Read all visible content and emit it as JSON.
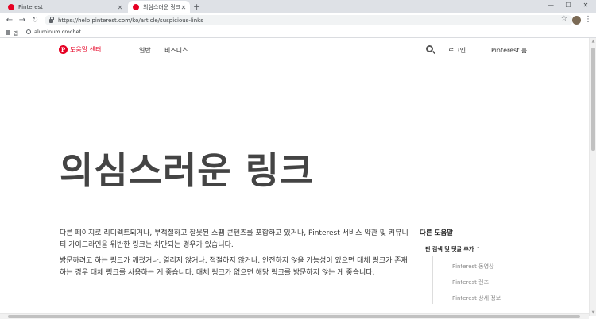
{
  "browser": {
    "tabs": [
      {
        "title": "Pinterest",
        "active": false
      },
      {
        "title": "의심스러운 링크 | Pinterest help",
        "active": true
      }
    ],
    "new_tab": "+",
    "url": "https://help.pinterest.com/ko/article/suspicious-links",
    "bookmarks": [
      {
        "label": "앱"
      },
      {
        "label": "aluminum crochet..."
      }
    ],
    "window_controls": [
      "—",
      "☐",
      "✕"
    ]
  },
  "site_nav": {
    "brand": "도움말 센터",
    "links": [
      "일반",
      "비즈니스"
    ],
    "login": "로그인",
    "home": "Pinterest 홈"
  },
  "article": {
    "title": "의심스러운 링크",
    "p1_a": "다른 페이지로 리디렉트되거나, 부적절하고 잘못된 스팸 콘텐츠를 포함하고 있거나, Pinterest ",
    "p1_link1": "서비스 약관",
    "p1_b": " 및 ",
    "p1_link2": "커뮤니티 가이드라인",
    "p1_c": "을 위반한 링크는 차단되는 경우가 있습니다.",
    "p2": "방문하려고 하는 링크가 깨졌거나, 열리지 않거나, 적절하지 않거나, 안전하지 않을 가능성이 있으면 대체 링크가 존재하는 경우 대체 링크를 사용하는 게 좋습니다. 대체 링크가 없으면 해당 링크를 방문하지 않는 게 좋습니다."
  },
  "aside": {
    "title": "다른 도움말",
    "subsection": "핀 검색 및 댓글 추가 ⌃",
    "items": [
      "Pinterest 동영상",
      "Pinterest 렌즈",
      "Pinterest 상세 정보"
    ]
  }
}
